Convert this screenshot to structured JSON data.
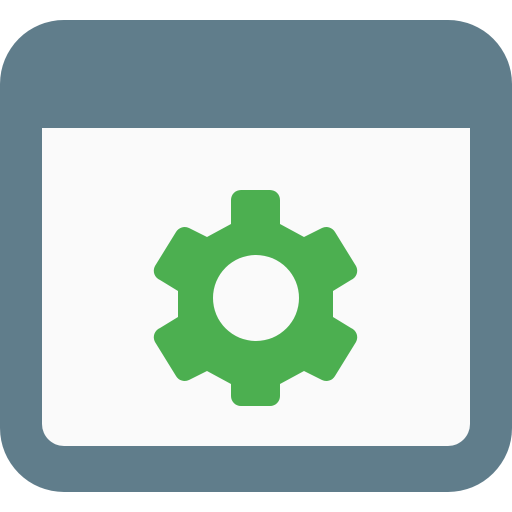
{
  "icon": {
    "name": "browser-settings-icon",
    "parts": [
      "browser-window-icon",
      "gear-icon"
    ]
  },
  "colors": {
    "window_frame": "#607D8B",
    "window_content": "#FAFAFA",
    "gear": "#4CAF50",
    "gear_hole": "#FAFAFA",
    "background": "#FFFFFF"
  }
}
